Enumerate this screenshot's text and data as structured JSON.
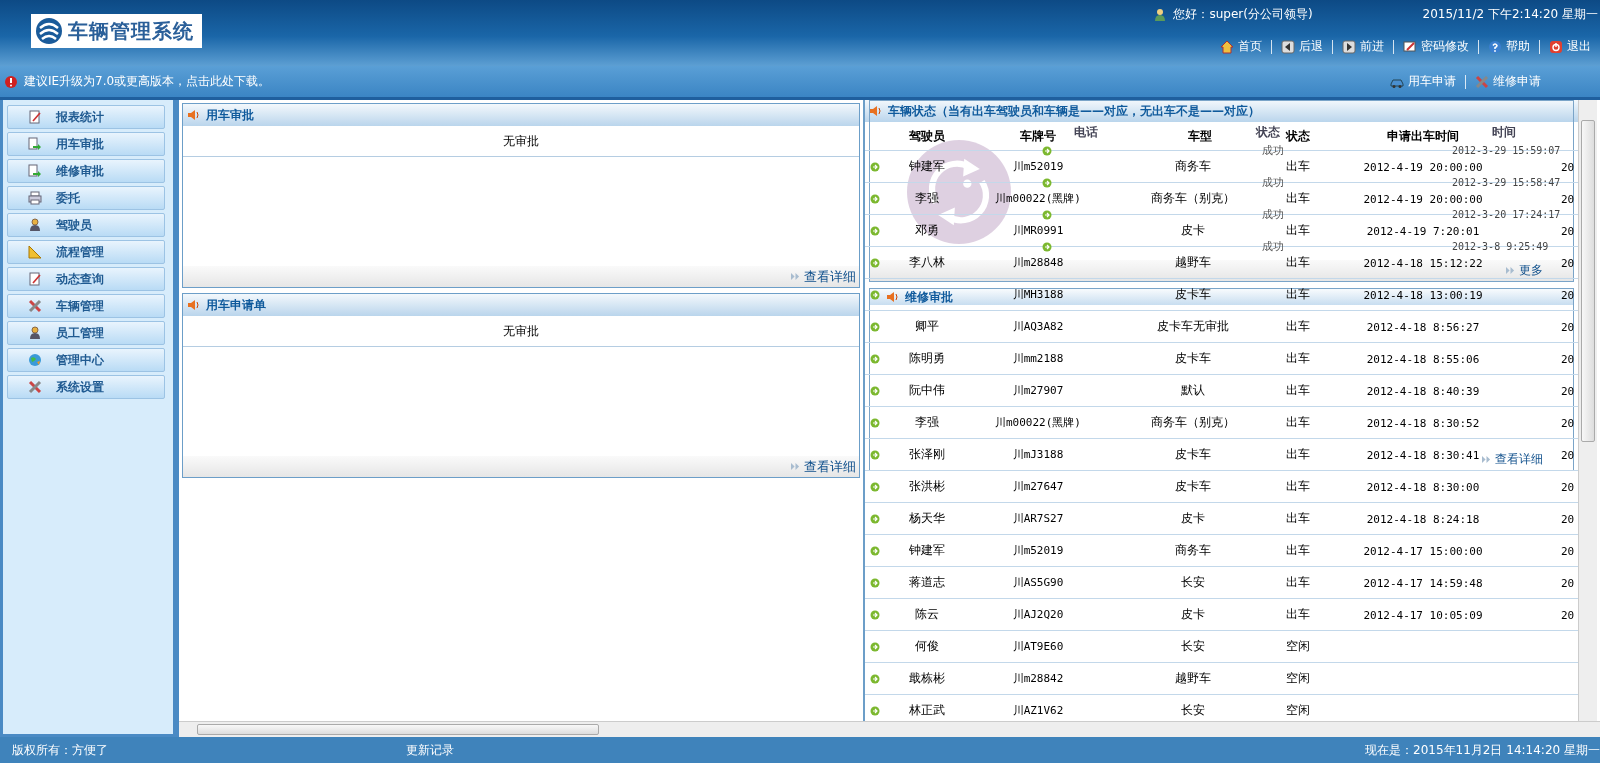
{
  "header": {
    "logo_text": "车辆管理系统",
    "greeting": "您好：super(分公司领导)",
    "datetime": "2015/11/2 下午2:14:20 星期一",
    "nav": [
      {
        "kind": "home",
        "label": "首页"
      },
      {
        "kind": "back",
        "label": "后退"
      },
      {
        "kind": "forward",
        "label": "前进"
      },
      {
        "kind": "password",
        "label": "密码修改"
      },
      {
        "kind": "help",
        "label": "帮助"
      },
      {
        "kind": "exit",
        "label": "退出"
      }
    ]
  },
  "notice": {
    "text": "建议IE升级为7.0或更高版本，点击此处下载。",
    "links": [
      {
        "kind": "car",
        "label": "用车申请"
      },
      {
        "kind": "tools",
        "label": "维修申请"
      }
    ]
  },
  "sidebar": {
    "items": [
      {
        "kind": "edit",
        "label": "报表统计"
      },
      {
        "kind": "arrow",
        "label": "用车审批"
      },
      {
        "kind": "arrow",
        "label": "维修审批"
      },
      {
        "kind": "printer",
        "label": "委托"
      },
      {
        "kind": "person",
        "label": "驾驶员"
      },
      {
        "kind": "ruler",
        "label": "流程管理"
      },
      {
        "kind": "edit",
        "label": "动态查询"
      },
      {
        "kind": "tools",
        "label": "车辆管理"
      },
      {
        "kind": "person",
        "label": "员工管理"
      },
      {
        "kind": "globe",
        "label": "管理中心"
      },
      {
        "kind": "tools",
        "label": "系统设置"
      }
    ]
  },
  "panels": [
    {
      "title": "用车审批",
      "message": "无审批",
      "link": "查看详细"
    },
    {
      "title": "用车申请单",
      "message": "无审批",
      "link": "查看详细"
    }
  ],
  "status_table": {
    "title": "车辆状态（当有出车驾驶员和车辆是——对应，无出车不是——对应）",
    "columns": [
      "驾驶员",
      "车牌号",
      "车型",
      "状态",
      "申请出车时间"
    ],
    "rows": [
      {
        "driver": "钟建军",
        "plate": "川m52019",
        "type": "商务车",
        "status": "出车",
        "time": "2012-4-19 20:00:00",
        "column_7": "20"
      },
      {
        "driver": "李强",
        "plate": "川m00022(黑牌)",
        "type": "商务车（别克）",
        "status": "出车",
        "time": "2012-4-19 20:00:00",
        "column_7": "20"
      },
      {
        "driver": "邓勇",
        "plate": "川MR0991",
        "type": "皮卡",
        "status": "出车",
        "time": "2012-4-19 7:20:01",
        "column_7": "20"
      },
      {
        "driver": "李八林",
        "plate": "川m28848",
        "type": "越野车",
        "status": "出车",
        "time": "2012-4-18 15:12:22",
        "column_7": "20"
      },
      {
        "plate": "川MH3188",
        "type": "皮卡车",
        "status": "出车",
        "time": "2012-4-18 13:00:19",
        "column_7": "20"
      },
      {
        "driver": "卿平",
        "plate": "川AQ3A82",
        "type": "皮卡车无审批",
        "status": "出车",
        "time": "2012-4-18 8:56:27",
        "column_7": "20"
      },
      {
        "driver": "陈明勇",
        "plate": "川mm2188",
        "type": "皮卡车",
        "status": "出车",
        "time": "2012-4-18 8:55:06",
        "column_7": "20"
      },
      {
        "driver": "阮中伟",
        "plate": "川m27907",
        "type": "默认",
        "status": "出车",
        "time": "2012-4-18 8:40:39",
        "column_7": "20"
      },
      {
        "driver": "李强",
        "plate": "川m00022(黑牌)",
        "type": "商务车（别克）",
        "status": "出车",
        "time": "2012-4-18 8:30:52",
        "column_7": "20"
      },
      {
        "driver": "张泽刚",
        "plate": "川mJ3188",
        "type": "皮卡车",
        "status": "出车",
        "time": "2012-4-18 8:30:41",
        "column_7": "20"
      },
      {
        "driver": "张洪彬",
        "plate": "川m27647",
        "type": "皮卡车",
        "status": "出车",
        "time": "2012-4-18 8:30:00",
        "column_7": "20"
      },
      {
        "driver": "杨天华",
        "plate": "川AR7S27",
        "type": "皮卡",
        "status": "出车",
        "time": "2012-4-18 8:24:18",
        "column_7": "20"
      },
      {
        "driver": "钟建军",
        "plate": "川m52019",
        "type": "商务车",
        "status": "出车",
        "time": "2012-4-17 15:00:00",
        "column_7": "20"
      },
      {
        "driver": "蒋道志",
        "plate": "川AS5G90",
        "type": "长安",
        "status": "出车",
        "time": "2012-4-17 14:59:48",
        "column_7": "20"
      },
      {
        "driver": "陈云",
        "plate": "川AJ2Q20",
        "type": "皮卡",
        "status": "出车",
        "time": "2012-4-17 10:05:09",
        "column_7": "20"
      },
      {
        "driver": "何俊",
        "plate": "川AT9E60",
        "type": "长安",
        "status": "空闲"
      },
      {
        "driver": "戢栋彬",
        "plate": "川m28842",
        "type": "越野车",
        "status": "空闲"
      },
      {
        "driver": "林正武",
        "plate": "川AZ1V62",
        "type": "长安",
        "status": "空闲"
      }
    ]
  },
  "overlay_panel": {
    "columns": [
      "电话",
      "状态",
      "时间"
    ],
    "rows": [
      {
        "result": "成功",
        "time": "2012-3-29 15:59:07"
      },
      {
        "result": "成功",
        "time": "2012-3-29 15:58:47"
      },
      {
        "result": "成功",
        "time": "2012-3-20 17:24:17"
      },
      {
        "result": "成功",
        "time": "2012-3-8 9:25:49"
      }
    ],
    "link": "更多"
  },
  "repair_panel": {
    "title": "维修审批",
    "link": "查看详细"
  },
  "footer": {
    "copyright": "版权所有：方便了",
    "changelog": "更新记录",
    "now": "现在是：2015年11月2日 14:14:20  星期一"
  }
}
